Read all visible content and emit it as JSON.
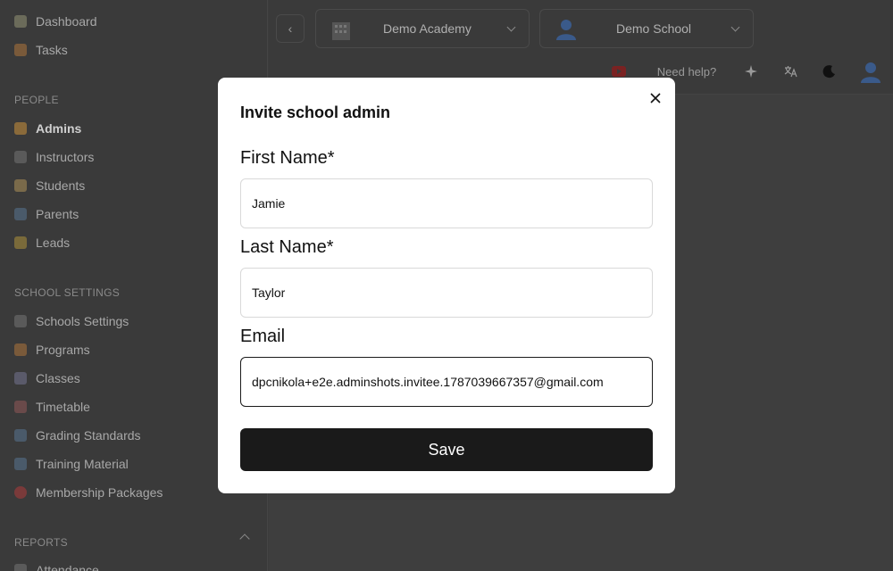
{
  "sidebar": {
    "top_items": [
      {
        "label": "Dashboard",
        "icon": "dashboard-icon"
      },
      {
        "label": "Tasks",
        "icon": "tasks-icon"
      }
    ],
    "people_label": "PEOPLE",
    "people_items": [
      {
        "label": "Admins",
        "icon": "admins-icon",
        "active": true
      },
      {
        "label": "Instructors",
        "icon": "instructors-icon"
      },
      {
        "label": "Students",
        "icon": "students-icon"
      },
      {
        "label": "Parents",
        "icon": "parents-icon"
      },
      {
        "label": "Leads",
        "icon": "leads-icon"
      }
    ],
    "school_settings_label": "SCHOOL SETTINGS",
    "school_settings_items": [
      {
        "label": "Schools Settings",
        "icon": "schools-settings-icon"
      },
      {
        "label": "Programs",
        "icon": "programs-icon"
      },
      {
        "label": "Classes",
        "icon": "classes-icon"
      },
      {
        "label": "Timetable",
        "icon": "timetable-icon"
      },
      {
        "label": "Grading Standards",
        "icon": "grading-icon"
      },
      {
        "label": "Training Material",
        "icon": "training-icon"
      },
      {
        "label": "Membership Packages",
        "icon": "membership-icon"
      }
    ],
    "reports_label": "REPORTS",
    "reports_items": [
      {
        "label": "Attendance",
        "icon": "attendance-icon"
      }
    ]
  },
  "topbar": {
    "academy_select": "Demo Academy",
    "school_select": "Demo School",
    "help_label": "Need help?"
  },
  "modal": {
    "title": "Invite school admin",
    "first_name_label": "First Name*",
    "first_name_value": "Jamie",
    "last_name_label": "Last Name*",
    "last_name_value": "Taylor",
    "email_label": "Email",
    "email_value": "dpcnikola+e2e.adminshots.invitee.1787039667357@gmail.com",
    "save_label": "Save"
  },
  "colors": {
    "overlay_bg": "#3c3c3c",
    "modal_bg": "#ffffff",
    "primary_button": "#1a1a1a",
    "input_border": "#d9d9d9",
    "focused_border": "#1a1a1a"
  }
}
